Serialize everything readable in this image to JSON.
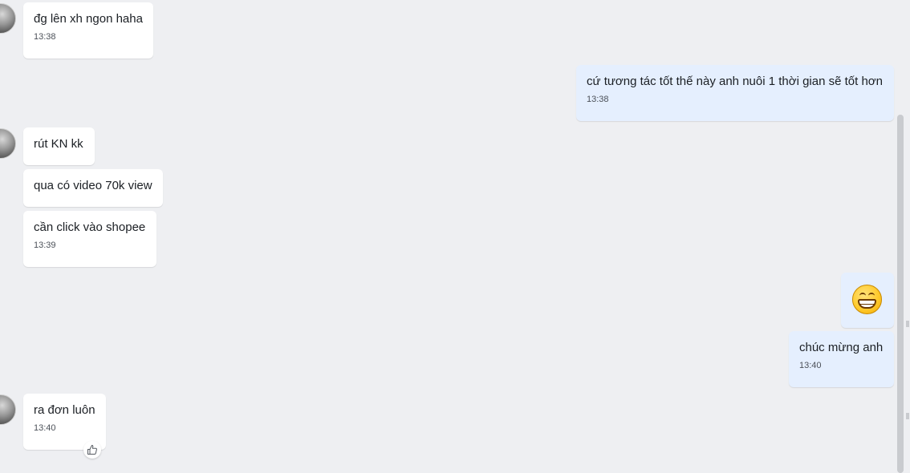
{
  "messages": [
    {
      "id": "m1",
      "direction": "incoming",
      "text": "đg lên xh ngon haha",
      "time": "13:38"
    },
    {
      "id": "m2",
      "direction": "outgoing",
      "text": "cứ tương tác tốt thế này anh nuôi 1 thời gian sẽ tốt hơn",
      "time": "13:38"
    },
    {
      "id": "m3",
      "direction": "incoming",
      "text": "rút KN kk",
      "time": ""
    },
    {
      "id": "m4",
      "direction": "incoming",
      "text": "qua có video 70k view",
      "time": ""
    },
    {
      "id": "m5",
      "direction": "incoming",
      "text": "cần click vào shopee",
      "time": "13:39"
    },
    {
      "id": "m6",
      "direction": "outgoing",
      "sticker": "grinning-face-emoji",
      "time": ""
    },
    {
      "id": "m7",
      "direction": "outgoing",
      "text": "chúc mừng anh",
      "time": "13:40"
    },
    {
      "id": "m8",
      "direction": "incoming",
      "text": "ra đơn luôn",
      "time": "13:40",
      "reaction_icon": "thumbs-up-icon"
    }
  ],
  "colors": {
    "background": "#eeeff2",
    "incoming_bubble": "#ffffff",
    "outgoing_bubble": "#e5effe",
    "text": "#1b1f24",
    "time": "#4b5058"
  }
}
